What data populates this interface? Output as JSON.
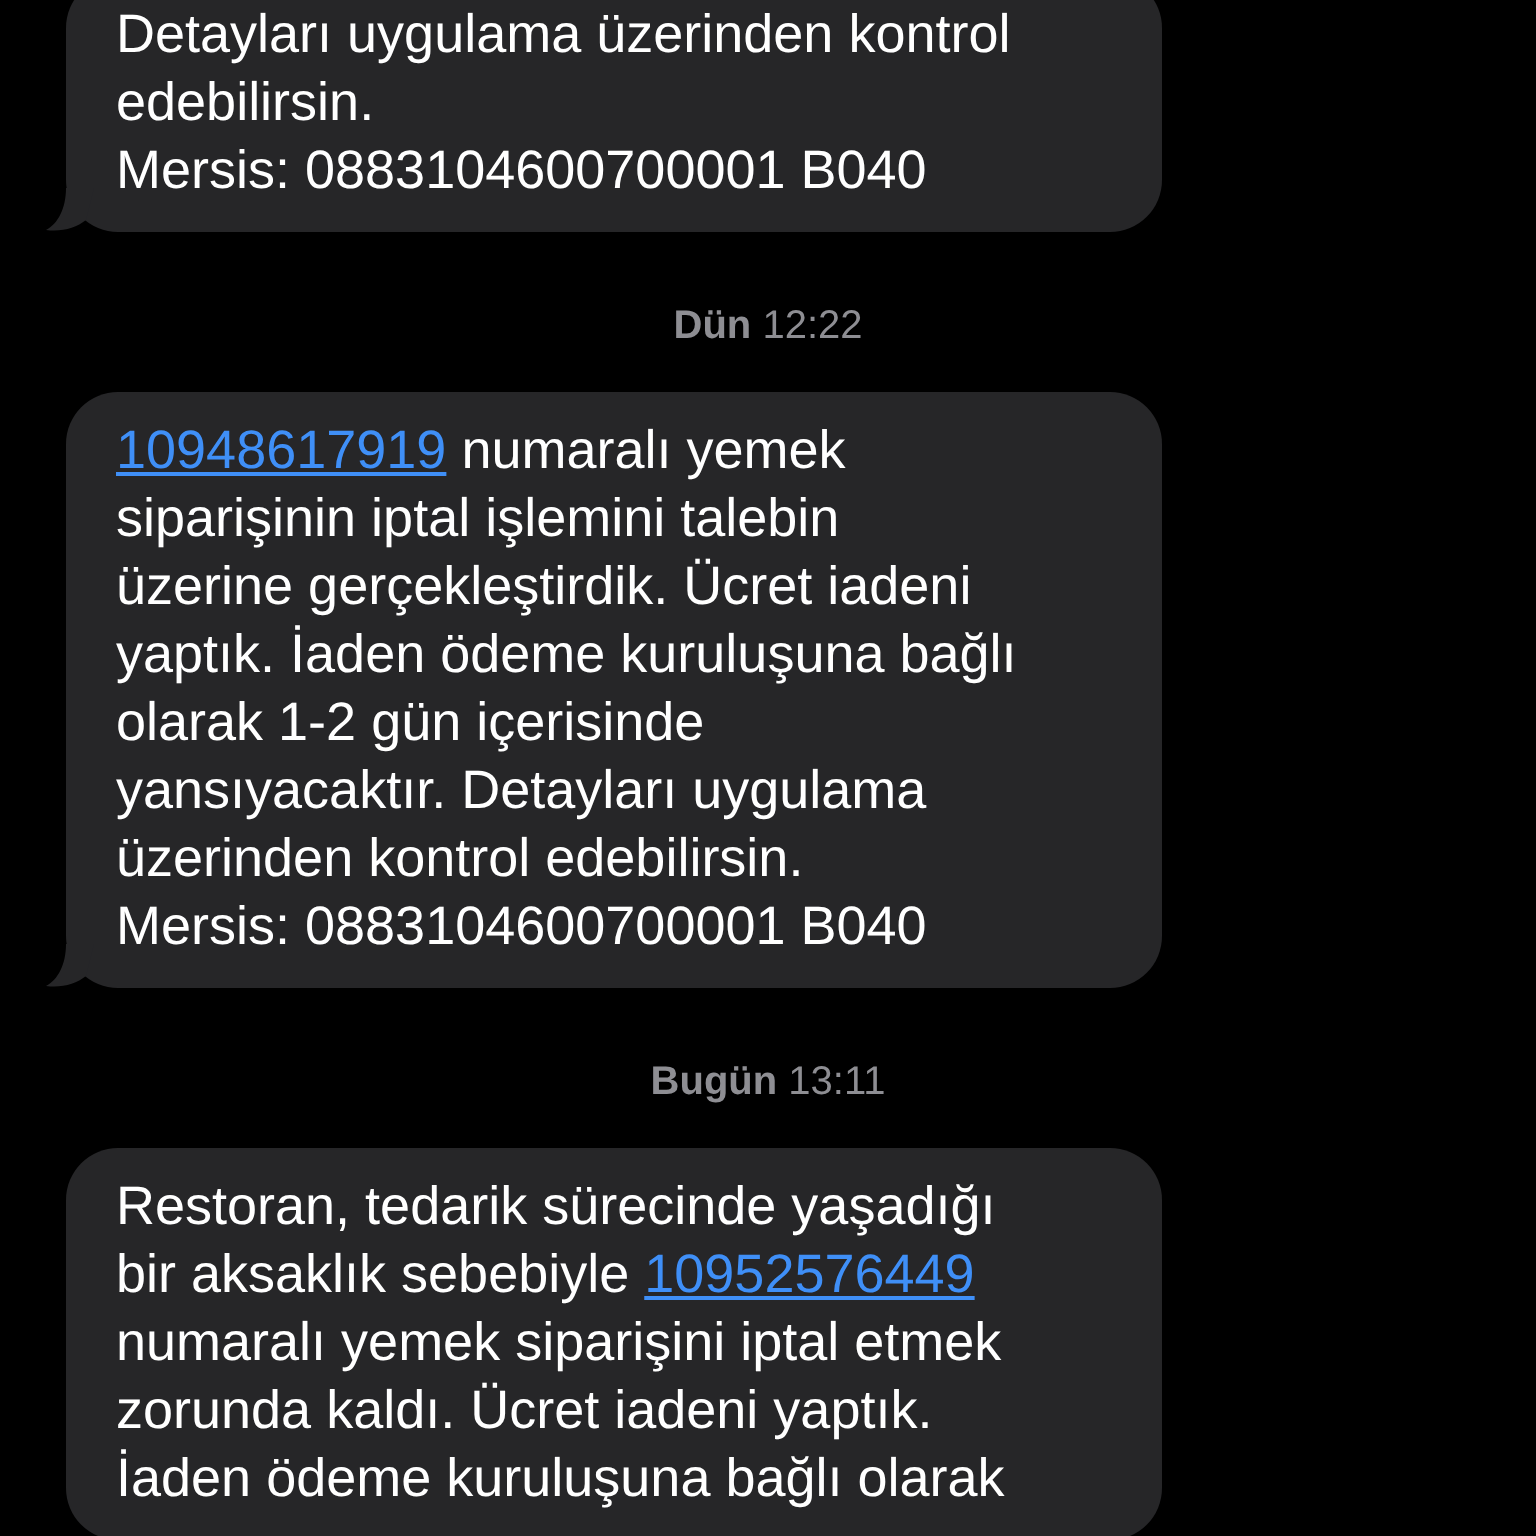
{
  "messages": [
    {
      "kind": "bubble",
      "tail": true,
      "parts": [
        {
          "kind": "text",
          "text": "Detayları uygulama üzerinden kontrol\nedebilirsin.\nMersis: 0883104600700001 B040"
        }
      ]
    },
    {
      "kind": "time",
      "text": "**Dün** 12:22"
    },
    {
      "kind": "bubble",
      "tail": true,
      "parts": [
        {
          "kind": "link",
          "text": "10948617919"
        },
        {
          "kind": "text",
          "text": " numaralı yemek\nsiparişinin iptal işlemini talebin\nüzerine gerçekleştirdik. Ücret iadeni\nyaptık. İaden ödeme kuruluşuna bağlı\nolarak 1-2 gün içerisinde\nyansıyacaktır. Detayları uygulama\nüzerinden kontrol edebilirsin.\nMersis: 0883104600700001 B040"
        }
      ]
    },
    {
      "kind": "time",
      "text": "**Bugün** 13:11"
    },
    {
      "kind": "bubble",
      "tail": false,
      "parts": [
        {
          "kind": "text",
          "text": "Restoran, tedarik sürecinde yaşadığı\nbir aksaklık sebebiyle "
        },
        {
          "kind": "link",
          "text": "10952576449"
        },
        {
          "kind": "text",
          "text": "\nnumaralı yemek siparişini iptal etmek\nzorunda kaldı. Ücret iadeni yaptık.\nİaden ödeme kuruluşuna bağlı olarak"
        }
      ]
    }
  ]
}
